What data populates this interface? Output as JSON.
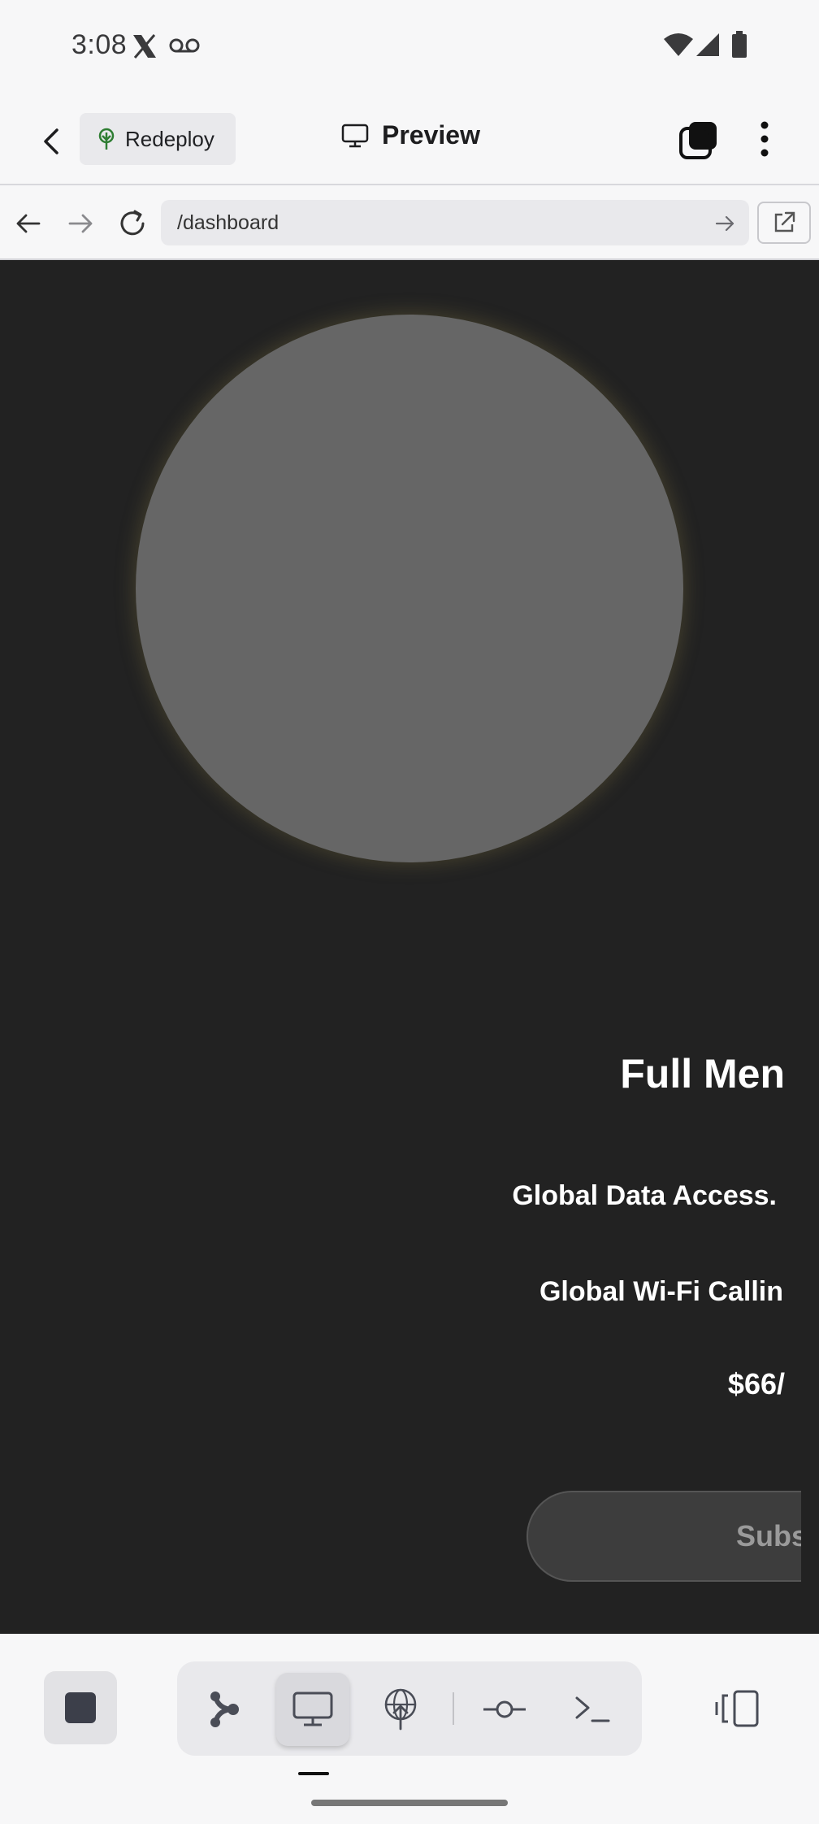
{
  "status_bar": {
    "time": "3:08"
  },
  "header": {
    "redeploy_label": "Redeploy",
    "title": "Preview"
  },
  "browser": {
    "url": "/dashboard"
  },
  "preview": {
    "plan_title": "Full Men",
    "features": [
      "Global Data Access.",
      "Global Wi-Fi Callin"
    ],
    "price": "$66/",
    "subscribe_label": "Subs"
  },
  "colors": {
    "preview_background": "#222222",
    "avatar_placeholder": "#666666",
    "redeploy_icon": "#2e7d32"
  }
}
